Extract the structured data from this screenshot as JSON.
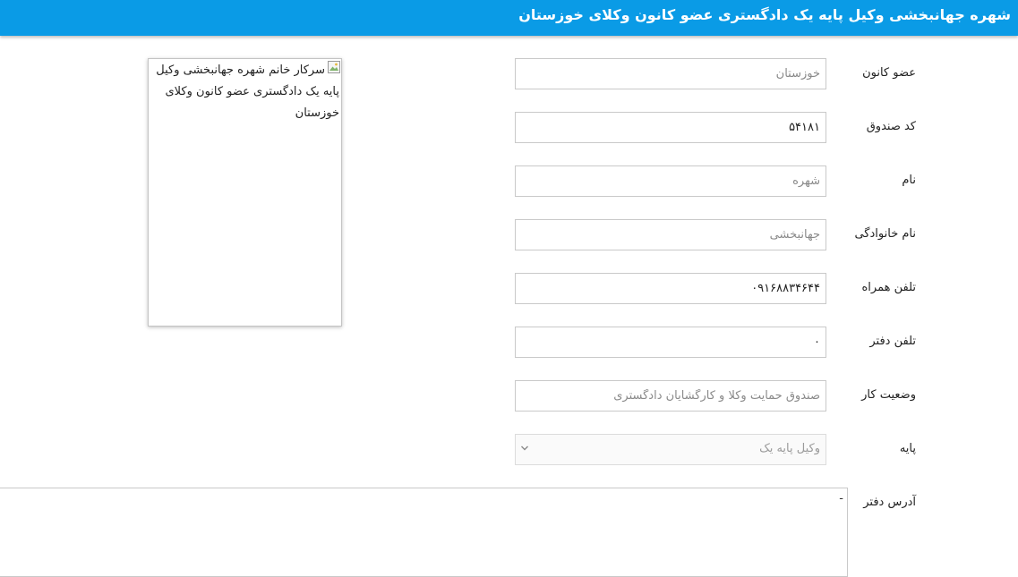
{
  "header": {
    "title": "شهره جهانبخشی وکیل پایه یک دادگستری عضو کانون وکلای خوزستان"
  },
  "photo": {
    "alt_text": "سرکار خانم شهره جهانبخشی وکیل پایه یک دادگستری عضو کانون وکلای خوزستان"
  },
  "fields": {
    "bar_association": {
      "label": "عضو کانون",
      "value": "خوزستان"
    },
    "fund_code": {
      "label": "کد صندوق",
      "value": "۵۴۱۸۱"
    },
    "first_name": {
      "label": "نام",
      "value": "شهره"
    },
    "last_name": {
      "label": "نام خانوادگی",
      "value": "جهانبخشی"
    },
    "mobile": {
      "label": "تلفن همراه",
      "value": "۰۹۱۶۸۸۳۴۶۴۴"
    },
    "office_phone": {
      "label": "تلفن دفتر",
      "value": "۰"
    },
    "work_status": {
      "label": "وضعیت کار",
      "value": "صندوق حمایت وکلا و کارگشایان دادگستری"
    },
    "grade": {
      "label": "پایه",
      "selected": "وکیل پایه یک"
    },
    "office_address": {
      "label": "آدرس دفتر",
      "value": "-"
    }
  },
  "colors": {
    "header_bg": "#0a9be6",
    "header_text": "#ffffff",
    "border": "#c9c9c9"
  }
}
